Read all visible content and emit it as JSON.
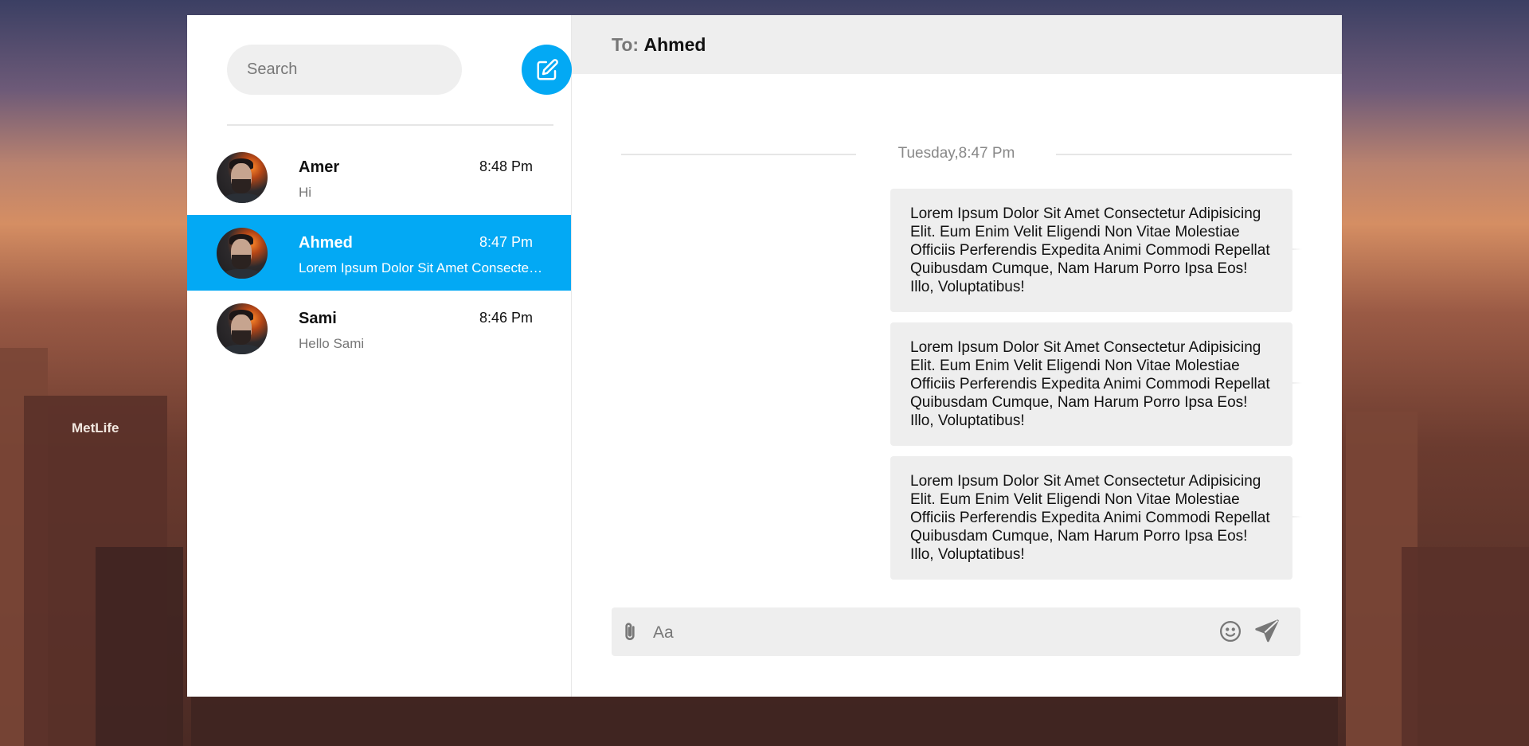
{
  "theme": {
    "accent": "#03a9f4",
    "panel_bg": "#eeeeee",
    "selected_text": "#ffffff"
  },
  "sidebar": {
    "search_placeholder": "Search",
    "compose_icon": "edit-square-icon",
    "contacts": [
      {
        "name": "Amer",
        "time": "8:48 Pm",
        "preview": "Hi",
        "active": false
      },
      {
        "name": "Ahmed",
        "time": "8:47 Pm",
        "preview": "Lorem Ipsum Dolor Sit Amet Consectetur Adipisicing Elit.",
        "active": true
      },
      {
        "name": "Sami",
        "time": "8:46 Pm",
        "preview": "Hello Sami",
        "active": false
      }
    ]
  },
  "chat": {
    "to_label": "To:",
    "to_name": "Ahmed",
    "date_divider": "Tuesday,8:47 Pm",
    "messages": [
      {
        "text": "Lorem Ipsum Dolor Sit Amet Consectetur Adipisicing Elit. Eum Enim Velit Eligendi Non Vitae Molestiae Officiis Perferendis Expedita Animi Commodi Repellat Quibusdam Cumque, Nam Harum Porro Ipsa Eos! Illo, Voluptatibus!"
      },
      {
        "text": "Lorem Ipsum Dolor Sit Amet Consectetur Adipisicing Elit. Eum Enim Velit Eligendi Non Vitae Molestiae Officiis Perferendis Expedita Animi Commodi Repellat Quibusdam Cumque, Nam Harum Porro Ipsa Eos! Illo, Voluptatibus!"
      },
      {
        "text": "Lorem Ipsum Dolor Sit Amet Consectetur Adipisicing Elit. Eum Enim Velit Eligendi Non Vitae Molestiae Officiis Perferendis Expedita Animi Commodi Repellat Quibusdam Cumque, Nam Harum Porro Ipsa Eos! Illo, Voluptatibus!"
      }
    ],
    "composer": {
      "placeholder": "Aa",
      "attach_icon": "paperclip-icon",
      "emoji_icon": "smiley-icon",
      "send_icon": "paper-plane-icon"
    }
  },
  "background": {
    "building_sign": "MetLife"
  }
}
